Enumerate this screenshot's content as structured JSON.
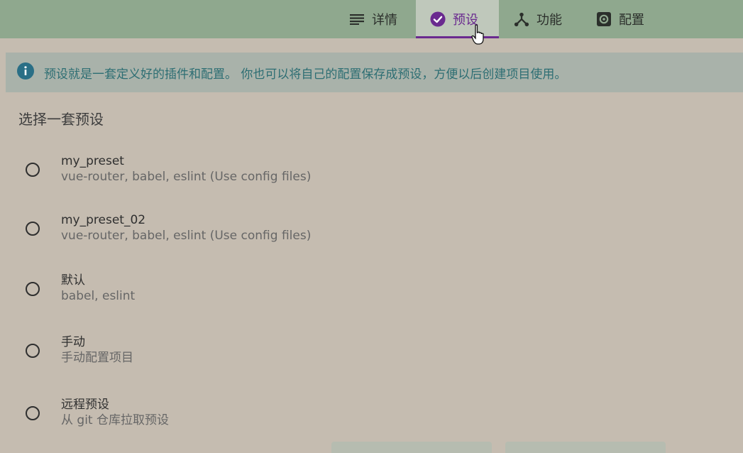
{
  "tabs": [
    {
      "label": "详情",
      "icon": "list-icon"
    },
    {
      "label": "预设",
      "icon": "check-circle-icon"
    },
    {
      "label": "功能",
      "icon": "fork-icon"
    },
    {
      "label": "配置",
      "icon": "gear-icon"
    }
  ],
  "info": {
    "text": "预设就是一套定义好的插件和配置。 你也可以将自己的配置保存成预设，方便以后创建项目使用。"
  },
  "section_title": "选择一套预设",
  "presets": [
    {
      "name": "my_preset",
      "desc": "vue-router, babel, eslint (Use config files)"
    },
    {
      "name": "my_preset_02",
      "desc": "vue-router, babel, eslint (Use config files)"
    },
    {
      "name": "默认",
      "desc": "babel, eslint"
    },
    {
      "name": "手动",
      "desc": "手动配置项目"
    },
    {
      "name": "远程预设",
      "desc": "从 git 仓库拉取预设"
    }
  ],
  "colors": {
    "accent": "#6a2a8f",
    "topbar": "#8fa88e",
    "info_bg": "#a9b2aa",
    "info_text": "#2d6e73",
    "page_bg": "#c5bcb0"
  }
}
